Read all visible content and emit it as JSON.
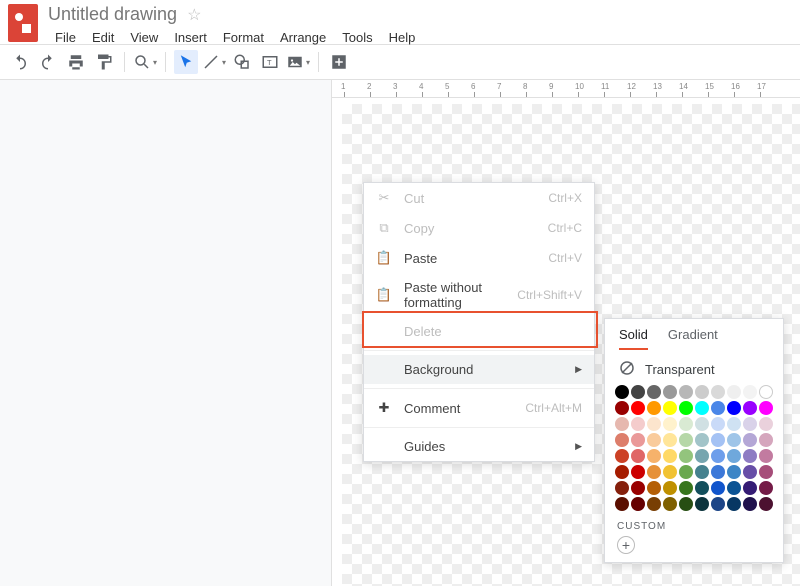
{
  "header": {
    "title": "Untitled drawing",
    "menus": [
      "File",
      "Edit",
      "View",
      "Insert",
      "Format",
      "Arrange",
      "Tools",
      "Help"
    ]
  },
  "ruler": {
    "ticks": [
      "1",
      "2",
      "3",
      "4",
      "5",
      "6",
      "7",
      "8",
      "9",
      "10",
      "11",
      "12",
      "13",
      "14",
      "15",
      "16",
      "17"
    ]
  },
  "context_menu": {
    "cut": {
      "label": "Cut",
      "shortcut": "Ctrl+X"
    },
    "copy": {
      "label": "Copy",
      "shortcut": "Ctrl+C"
    },
    "paste": {
      "label": "Paste",
      "shortcut": "Ctrl+V"
    },
    "paste_nf": {
      "label": "Paste without formatting",
      "shortcut": "Ctrl+Shift+V"
    },
    "delete": {
      "label": "Delete"
    },
    "background": {
      "label": "Background"
    },
    "comment": {
      "label": "Comment",
      "shortcut": "Ctrl+Alt+M"
    },
    "guides": {
      "label": "Guides"
    }
  },
  "color_popup": {
    "tab_solid": "Solid",
    "tab_gradient": "Gradient",
    "transparent": "Transparent",
    "custom": "CUSTOM",
    "rows": [
      [
        "#000000",
        "#434343",
        "#666666",
        "#999999",
        "#b7b7b7",
        "#cccccc",
        "#d9d9d9",
        "#efefef",
        "#f3f3f3",
        "#ffffff"
      ],
      [
        "#980000",
        "#ff0000",
        "#ff9900",
        "#ffff00",
        "#00ff00",
        "#00ffff",
        "#4a86e8",
        "#0000ff",
        "#9900ff",
        "#ff00ff"
      ],
      [
        "#e6b8af",
        "#f4cccc",
        "#fce5cd",
        "#fff2cc",
        "#d9ead3",
        "#d0e0e3",
        "#c9daf8",
        "#cfe2f3",
        "#d9d2e9",
        "#ead1dc"
      ],
      [
        "#dd7e6b",
        "#ea9999",
        "#f9cb9c",
        "#ffe599",
        "#b6d7a8",
        "#a2c4c9",
        "#a4c2f4",
        "#9fc5e8",
        "#b4a7d6",
        "#d5a6bd"
      ],
      [
        "#cc4125",
        "#e06666",
        "#f6b26b",
        "#ffd966",
        "#93c47d",
        "#76a5af",
        "#6d9eeb",
        "#6fa8dc",
        "#8e7cc3",
        "#c27ba0"
      ],
      [
        "#a61c00",
        "#cc0000",
        "#e69138",
        "#f1c232",
        "#6aa84f",
        "#45818e",
        "#3c78d8",
        "#3d85c6",
        "#674ea7",
        "#a64d79"
      ],
      [
        "#85200c",
        "#990000",
        "#b45f06",
        "#bf9000",
        "#38761d",
        "#134f5c",
        "#1155cc",
        "#0b5394",
        "#351c75",
        "#741b47"
      ],
      [
        "#5b0f00",
        "#660000",
        "#783f04",
        "#7f6000",
        "#274e13",
        "#0c343d",
        "#1c4587",
        "#073763",
        "#20124d",
        "#4c1130"
      ]
    ]
  }
}
